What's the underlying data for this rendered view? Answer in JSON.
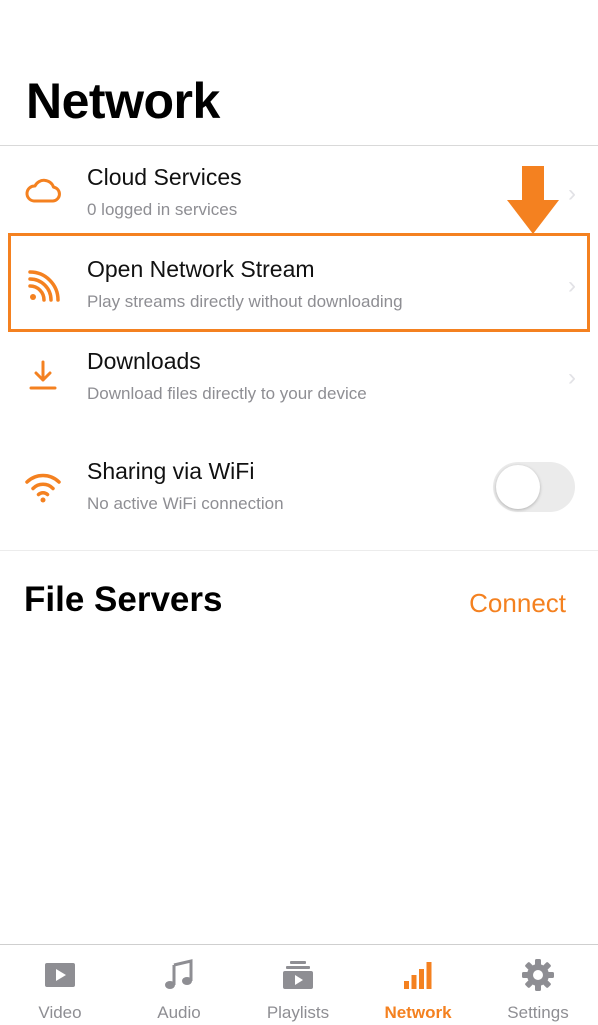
{
  "header": {
    "title": "Network"
  },
  "network_items": [
    {
      "title": "Cloud Services",
      "subtitle": "0 logged in services",
      "icon": "cloud-icon"
    },
    {
      "title": "Open Network Stream",
      "subtitle": "Play streams directly without downloading",
      "icon": "stream-icon"
    },
    {
      "title": "Downloads",
      "subtitle": "Download files directly to your device",
      "icon": "download-icon"
    },
    {
      "title": "Sharing via WiFi",
      "subtitle": "No active WiFi connection",
      "icon": "wifi-icon",
      "toggle_on": false
    }
  ],
  "file_servers": {
    "title": "File Servers",
    "connect_label": "Connect"
  },
  "tabs": [
    {
      "label": "Video",
      "icon": "video-icon"
    },
    {
      "label": "Audio",
      "icon": "music-note-icon"
    },
    {
      "label": "Playlists",
      "icon": "playlists-icon"
    },
    {
      "label": "Network",
      "icon": "network-bars-icon",
      "active": true
    },
    {
      "label": "Settings",
      "icon": "gear-icon"
    }
  ],
  "colors": {
    "accent": "#f48120",
    "secondary_text": "#8e8e93",
    "tab_inactive": "#8e8e93"
  }
}
